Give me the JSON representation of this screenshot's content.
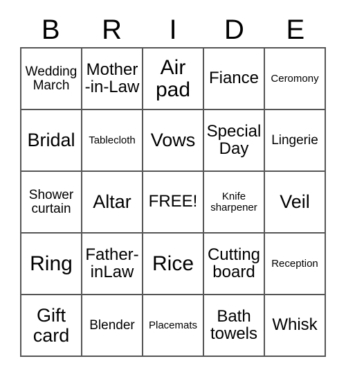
{
  "card": {
    "title_letters": [
      "B",
      "R",
      "I",
      "D",
      "E"
    ],
    "free_space_label": "FREE!",
    "border_color": "#555555",
    "text_color": "#000000",
    "background_color": "#ffffff",
    "columns": 5,
    "rows": 5
  },
  "grid": [
    [
      {
        "label": "Wedding March",
        "size": "sm"
      },
      {
        "label": "Mother-in-Law",
        "size": "md"
      },
      {
        "label": "Air pad",
        "size": "xl"
      },
      {
        "label": "Fiance",
        "size": "md"
      },
      {
        "label": "Ceromony",
        "size": "xs"
      }
    ],
    [
      {
        "label": "Bridal",
        "size": "lg"
      },
      {
        "label": "Tablecloth",
        "size": "xs"
      },
      {
        "label": "Vows",
        "size": "lg"
      },
      {
        "label": "Special Day",
        "size": "md"
      },
      {
        "label": "Lingerie",
        "size": "sm"
      }
    ],
    [
      {
        "label": "Shower curtain",
        "size": "sm"
      },
      {
        "label": "Altar",
        "size": "lg"
      },
      {
        "label": "FREE!",
        "size": "md"
      },
      {
        "label": "Knife sharpener",
        "size": "xs"
      },
      {
        "label": "Veil",
        "size": "lg"
      }
    ],
    [
      {
        "label": "Ring",
        "size": "xl"
      },
      {
        "label": "Father-inLaw",
        "size": "md"
      },
      {
        "label": "Rice",
        "size": "xl"
      },
      {
        "label": "Cutting board",
        "size": "md"
      },
      {
        "label": "Reception",
        "size": "xs"
      }
    ],
    [
      {
        "label": "Gift card",
        "size": "lg"
      },
      {
        "label": "Blender",
        "size": "sm"
      },
      {
        "label": "Placemats",
        "size": "xs"
      },
      {
        "label": "Bath towels",
        "size": "md"
      },
      {
        "label": "Whisk",
        "size": "md"
      }
    ]
  ]
}
